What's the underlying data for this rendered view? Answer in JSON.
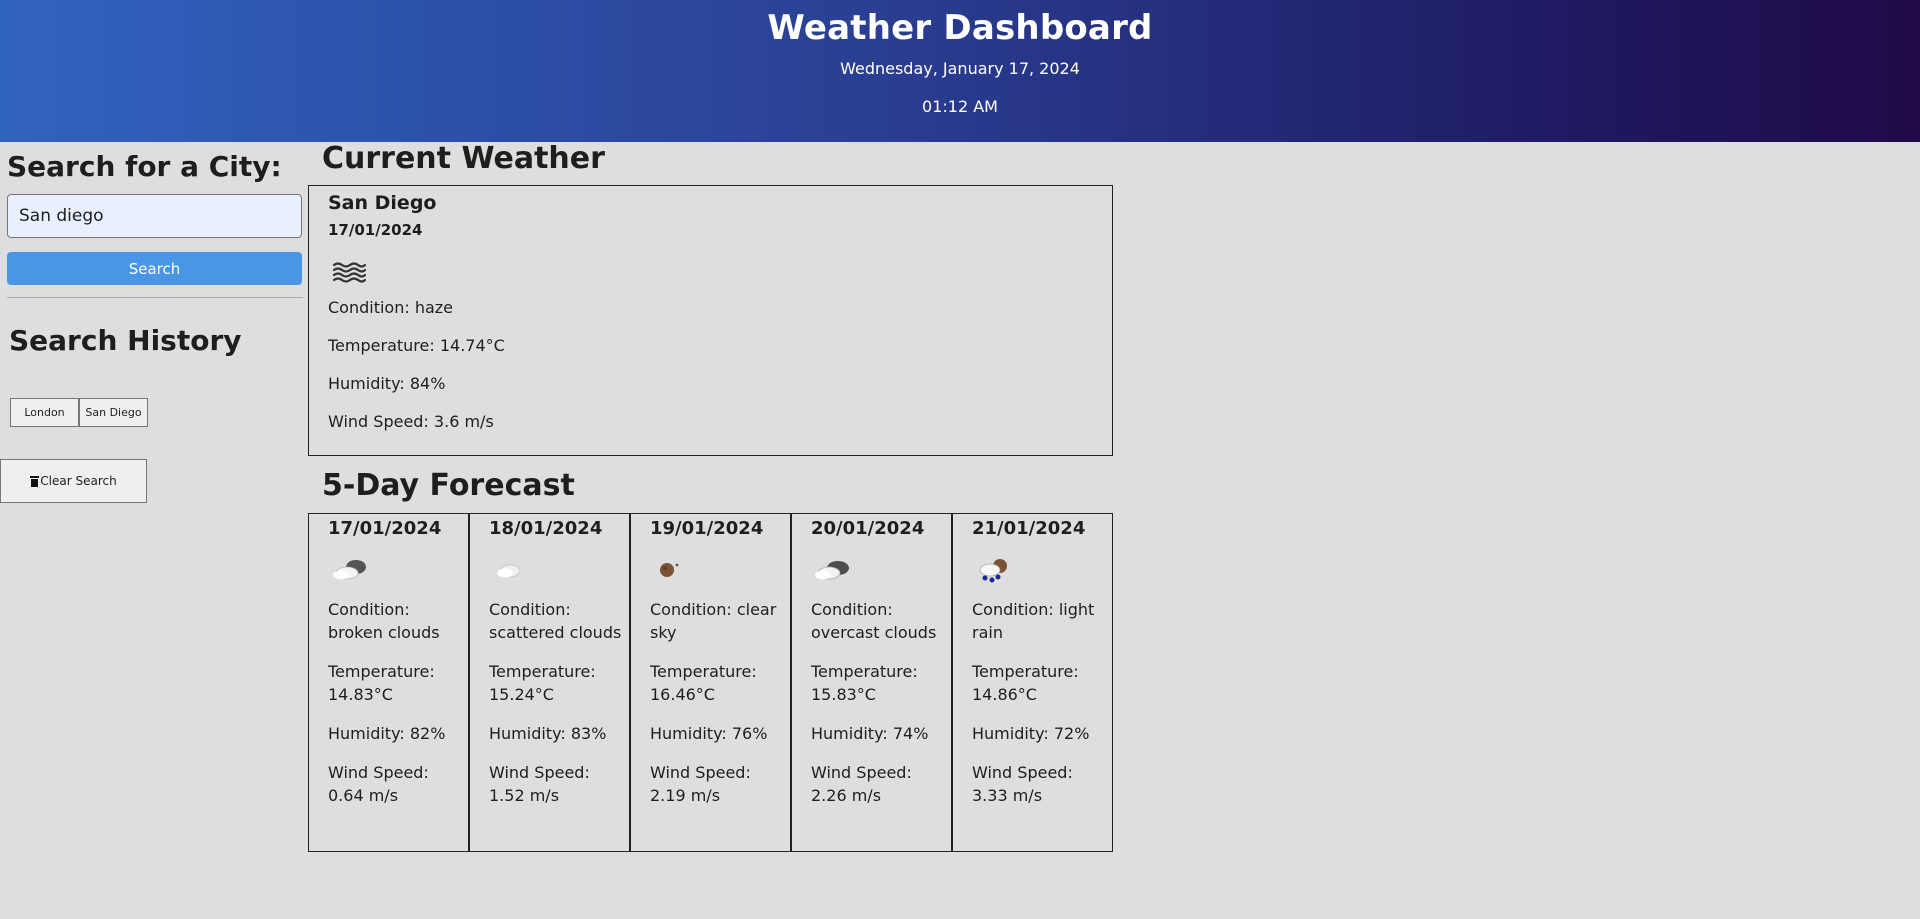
{
  "header": {
    "title": "Weather Dashboard",
    "date": "Wednesday, January 17, 2024",
    "time": "01:12 AM"
  },
  "sidebar": {
    "search_title": "Search for a City:",
    "search_value": "San diego",
    "search_button": "Search",
    "history_title": "Search History",
    "history": [
      "London",
      "San Diego"
    ],
    "clear_button": "Clear Search"
  },
  "current": {
    "section_title": "Current Weather",
    "city": "San Diego",
    "date": "17/01/2024",
    "icon": "haze-icon",
    "condition": "Condition: haze",
    "temperature": "Temperature: 14.74°C",
    "humidity": "Humidity: 84%",
    "wind": "Wind Speed: 3.6 m/s"
  },
  "forecast": {
    "section_title": "5-Day Forecast",
    "days": [
      {
        "date": "17/01/2024",
        "icon": "broken-clouds-icon",
        "condition": "Condition: broken clouds",
        "temperature": "Temperature: 14.83°C",
        "humidity": "Humidity: 82%",
        "wind": "Wind Speed: 0.64 m/s"
      },
      {
        "date": "18/01/2024",
        "icon": "scattered-clouds-icon",
        "condition": "Condition: scattered clouds",
        "temperature": "Temperature: 15.24°C",
        "humidity": "Humidity: 83%",
        "wind": "Wind Speed: 1.52 m/s"
      },
      {
        "date": "19/01/2024",
        "icon": "clear-sky-night-icon",
        "condition": "Condition: clear sky",
        "temperature": "Temperature: 16.46°C",
        "humidity": "Humidity: 76%",
        "wind": "Wind Speed: 2.19 m/s"
      },
      {
        "date": "20/01/2024",
        "icon": "overcast-clouds-icon",
        "condition": "Condition: overcast clouds",
        "temperature": "Temperature: 15.83°C",
        "humidity": "Humidity: 74%",
        "wind": "Wind Speed: 2.26 m/s"
      },
      {
        "date": "21/01/2024",
        "icon": "light-rain-icon",
        "condition": "Condition: light rain",
        "temperature": "Temperature: 14.86°C",
        "humidity": "Humidity: 72%",
        "wind": "Wind Speed: 3.33 m/s"
      }
    ]
  },
  "colors": {
    "header_start": "#3063bf",
    "header_end": "#200a48",
    "page_bg": "#dedede",
    "search_button": "#4a96e4",
    "input_bg": "#e8f0fe"
  }
}
